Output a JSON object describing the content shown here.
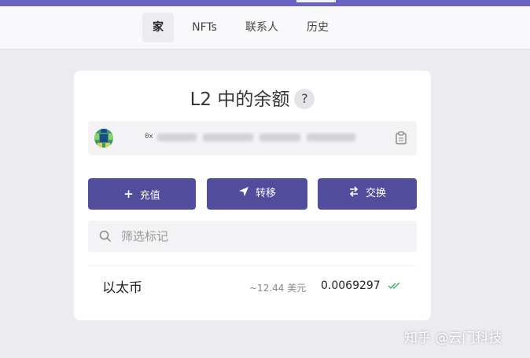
{
  "nav": {
    "tabs": [
      {
        "label": "家",
        "active": true
      },
      {
        "label": "NFTs",
        "active": false
      },
      {
        "label": "联系人",
        "active": false
      },
      {
        "label": "历史",
        "active": false
      }
    ]
  },
  "balance_card": {
    "title": "L2 中的余额",
    "help_glyph": "?",
    "address_prefix": "0x",
    "actions": {
      "deposit_label": "充值",
      "transfer_label": "转移",
      "swap_label": "交换"
    },
    "search_placeholder": "筛选标记",
    "tokens": [
      {
        "name": "以太币",
        "fiat": "~12.44 美元",
        "amount": "0.0069297",
        "verified_color": "#3bb36b"
      }
    ]
  },
  "watermark": "知乎 @云门科技",
  "colors": {
    "accent": "#524c9c",
    "top_bar": "#6b63c4",
    "background": "#ececf0"
  },
  "icons": [
    "plus-icon",
    "send-icon",
    "swap-icon",
    "search-icon",
    "clipboard-icon",
    "double-check-icon"
  ]
}
